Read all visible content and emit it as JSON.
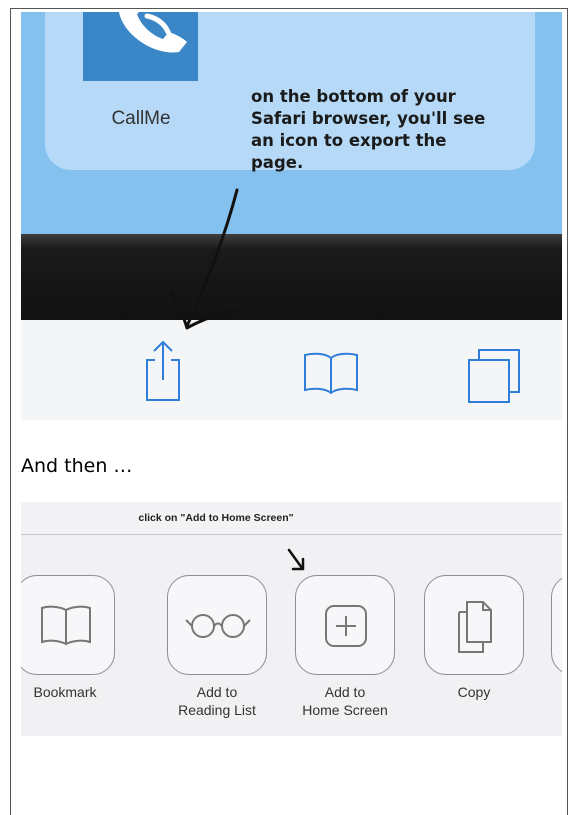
{
  "screenshot1": {
    "app_label": "CallMe",
    "note_lines": [
      "on the bottom of your",
      "Safari browser, you'll see",
      "an icon to export the",
      "page."
    ],
    "toolbar_icons": [
      "share-icon",
      "bookmarks-icon",
      "tabs-icon"
    ],
    "colors": {
      "ios_blue": "#2f7ed8",
      "app_bg": "#84c1ee",
      "icon_bg": "#3a86c6"
    }
  },
  "caption": "And then …",
  "screenshot2": {
    "instruction": "click on \"Add to Home Screen\"",
    "actions": [
      {
        "icon": "bookmark-book-icon",
        "label_lines": [
          "Bookmark"
        ]
      },
      {
        "icon": "reading-list-glasses-icon",
        "label_lines": [
          "Add to",
          "Reading List"
        ]
      },
      {
        "icon": "add-plus-icon",
        "label_lines": [
          "Add to",
          "Home Screen"
        ]
      },
      {
        "icon": "copy-documents-icon",
        "label_lines": [
          "Copy"
        ]
      }
    ]
  }
}
